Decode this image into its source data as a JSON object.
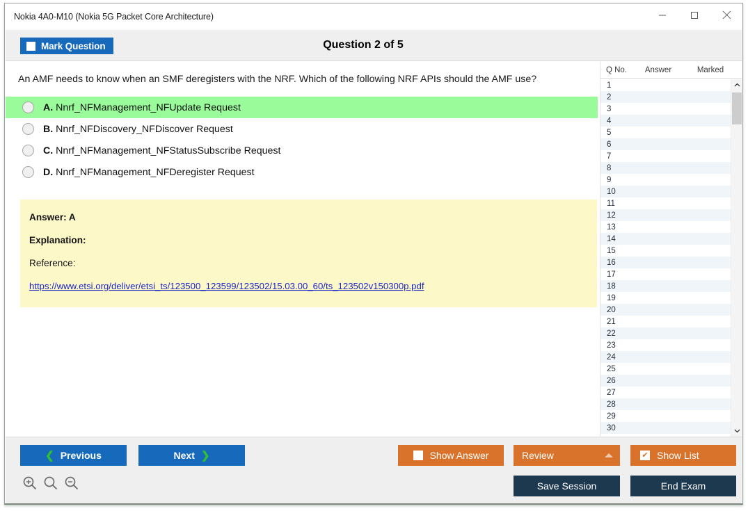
{
  "window": {
    "title": "Nokia 4A0-M10 (Nokia 5G Packet Core Architecture)",
    "minimize_label": "Minimize",
    "maximize_label": "Maximize",
    "close_label": "Close"
  },
  "header": {
    "mark_question_label": "Mark Question",
    "question_title": "Question 2 of 5"
  },
  "question": {
    "text": "An AMF needs to know when an SMF deregisters with the NRF. Which of the following NRF APIs should the AMF use?",
    "options": [
      {
        "letter": "A.",
        "text": "Nnrf_NFManagement_NFUpdate Request",
        "correct": true
      },
      {
        "letter": "B.",
        "text": "Nnrf_NFDiscovery_NFDiscover Request",
        "correct": false
      },
      {
        "letter": "C.",
        "text": "Nnrf_NFManagement_NFStatusSubscribe Request",
        "correct": false
      },
      {
        "letter": "D.",
        "text": "Nnrf_NFManagement_NFDeregister Request",
        "correct": false
      }
    ]
  },
  "answer_box": {
    "answer_line": "Answer: A",
    "explanation_label": "Explanation:",
    "reference_label": "Reference:",
    "reference_url": "https://www.etsi.org/deliver/etsi_ts/123500_123599/123502/15.03.00_60/ts_123502v150300p.pdf"
  },
  "question_list": {
    "columns": [
      "Q No.",
      "Answer",
      "Marked"
    ],
    "rows": [
      {
        "no": "1",
        "answer": "",
        "marked": ""
      },
      {
        "no": "2",
        "answer": "",
        "marked": ""
      },
      {
        "no": "3",
        "answer": "",
        "marked": ""
      },
      {
        "no": "4",
        "answer": "",
        "marked": ""
      },
      {
        "no": "5",
        "answer": "",
        "marked": ""
      },
      {
        "no": "6",
        "answer": "",
        "marked": ""
      },
      {
        "no": "7",
        "answer": "",
        "marked": ""
      },
      {
        "no": "8",
        "answer": "",
        "marked": ""
      },
      {
        "no": "9",
        "answer": "",
        "marked": ""
      },
      {
        "no": "10",
        "answer": "",
        "marked": ""
      },
      {
        "no": "11",
        "answer": "",
        "marked": ""
      },
      {
        "no": "12",
        "answer": "",
        "marked": ""
      },
      {
        "no": "13",
        "answer": "",
        "marked": ""
      },
      {
        "no": "14",
        "answer": "",
        "marked": ""
      },
      {
        "no": "15",
        "answer": "",
        "marked": ""
      },
      {
        "no": "16",
        "answer": "",
        "marked": ""
      },
      {
        "no": "17",
        "answer": "",
        "marked": ""
      },
      {
        "no": "18",
        "answer": "",
        "marked": ""
      },
      {
        "no": "19",
        "answer": "",
        "marked": ""
      },
      {
        "no": "20",
        "answer": "",
        "marked": ""
      },
      {
        "no": "21",
        "answer": "",
        "marked": ""
      },
      {
        "no": "22",
        "answer": "",
        "marked": ""
      },
      {
        "no": "23",
        "answer": "",
        "marked": ""
      },
      {
        "no": "24",
        "answer": "",
        "marked": ""
      },
      {
        "no": "25",
        "answer": "",
        "marked": ""
      },
      {
        "no": "26",
        "answer": "",
        "marked": ""
      },
      {
        "no": "27",
        "answer": "",
        "marked": ""
      },
      {
        "no": "28",
        "answer": "",
        "marked": ""
      },
      {
        "no": "29",
        "answer": "",
        "marked": ""
      },
      {
        "no": "30",
        "answer": "",
        "marked": ""
      }
    ]
  },
  "toolbar": {
    "previous_label": "Previous",
    "next_label": "Next",
    "show_answer_label": "Show Answer",
    "show_answer_checked": false,
    "review_label": "Review",
    "show_list_label": "Show List",
    "show_list_checked": true,
    "show_list_check_glyph": "✔",
    "save_session_label": "Save Session",
    "end_exam_label": "End Exam",
    "zoom_in_name": "zoom-in",
    "zoom_reset_name": "zoom-reset",
    "zoom_out_name": "zoom-out"
  },
  "colors": {
    "primary_blue": "#1769bc",
    "orange": "#d9722a",
    "dark_navy": "#1d3950",
    "correct_green": "#99fb99",
    "answer_yellow": "#fcf8c8",
    "link_blue": "#1b24c9",
    "chevron_green": "#2fc22f"
  }
}
